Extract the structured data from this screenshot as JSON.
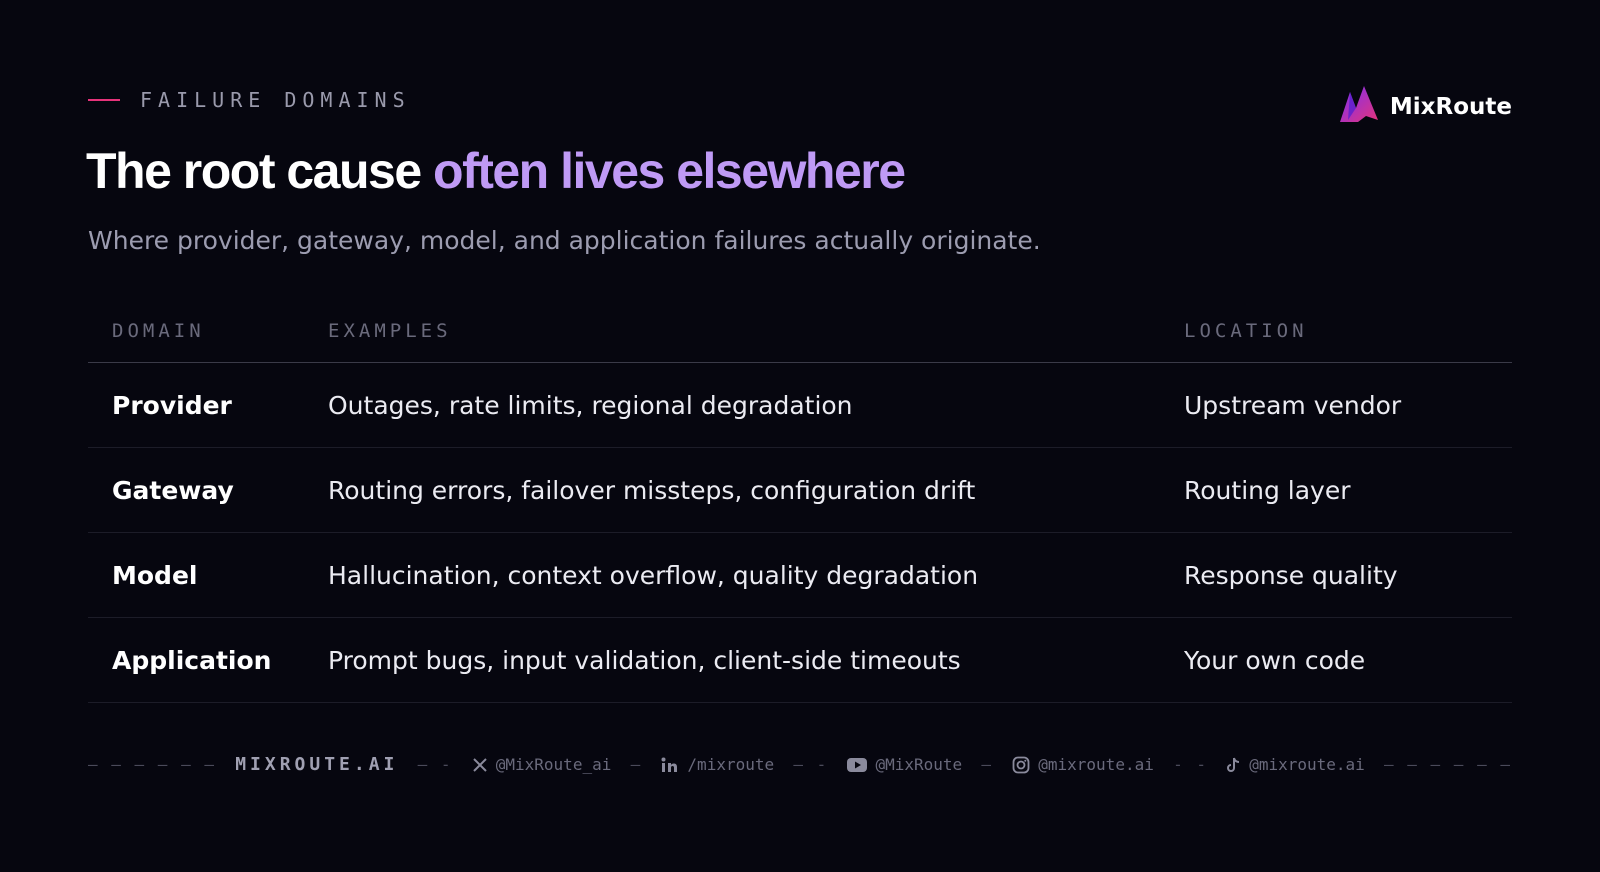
{
  "header": {
    "eyebrow": "FAILURE DOMAINS",
    "title_plain": "The root cause ",
    "title_accent": "often lives elsewhere",
    "subtitle": "Where provider, gateway, model, and application failures actually originate."
  },
  "brand": {
    "name": "MixRoute",
    "logo_icon": "mixroute-logo-icon"
  },
  "table": {
    "columns": [
      "DOMAIN",
      "EXAMPLES",
      "LOCATION"
    ],
    "rows": [
      {
        "domain": "Provider",
        "examples": "Outages, rate limits, regional degradation",
        "location": "Upstream vendor"
      },
      {
        "domain": "Gateway",
        "examples": "Routing errors, failover missteps, configuration drift",
        "location": "Routing layer"
      },
      {
        "domain": "Model",
        "examples": "Hallucination, context overflow, quality degradation",
        "location": "Response quality"
      },
      {
        "domain": "Application",
        "examples": "Prompt bugs, input validation, client-side timeouts",
        "location": "Your own code"
      }
    ]
  },
  "footer": {
    "site": "MIXROUTE.AI",
    "socials": [
      {
        "icon": "x-icon",
        "handle": "@MixRoute_ai"
      },
      {
        "icon": "linkedin-icon",
        "handle": "/mixroute"
      },
      {
        "icon": "youtube-icon",
        "handle": "@MixRoute"
      },
      {
        "icon": "instagram-icon",
        "handle": "@mixroute.ai"
      },
      {
        "icon": "tiktok-icon",
        "handle": "@mixroute.ai"
      }
    ]
  },
  "colors": {
    "background": "#06060f",
    "accent_text": "#bf9af5",
    "eyebrow_dash": "#e6337a",
    "logo_gradient": [
      "#7b2ff7",
      "#e6337a"
    ]
  }
}
